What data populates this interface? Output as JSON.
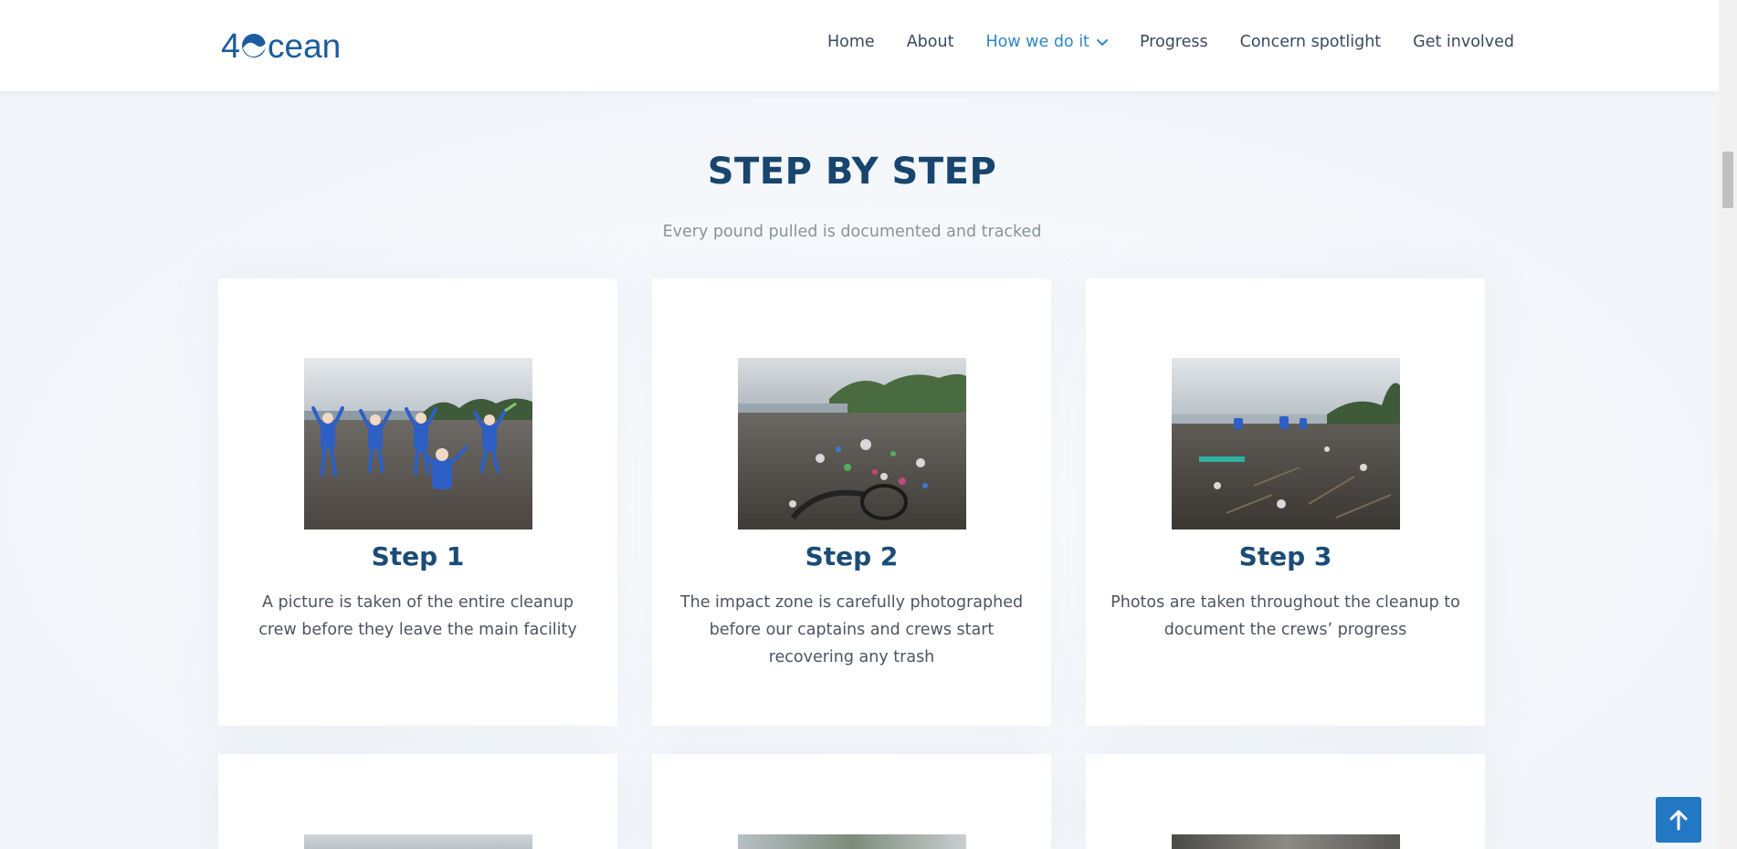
{
  "header": {
    "logo_text": "4Ocean",
    "nav": [
      {
        "label": "Home"
      },
      {
        "label": "About"
      },
      {
        "label": "How we do it",
        "active": true
      },
      {
        "label": "Progress"
      },
      {
        "label": "Concern spotlight"
      },
      {
        "label": "Get involved"
      }
    ]
  },
  "section": {
    "title": "STEP BY STEP",
    "subtitle": "Every pound pulled is documented and tracked"
  },
  "steps": [
    {
      "title": "Step 1",
      "text": "A picture is taken of the entire cleanup crew before they leave the main facility",
      "photo": "crew-on-beach-photo"
    },
    {
      "title": "Step 2",
      "text": "The impact zone is carefully photographed before our captains and crews start recovering any trash",
      "photo": "trash-on-beach-photo"
    },
    {
      "title": "Step 3",
      "text": "Photos are taken throughout the cleanup to document the crews’ progress",
      "photo": "crew-cleaning-photo"
    }
  ],
  "colors": {
    "brand": "#1b5c9e",
    "accent": "#2f86c6",
    "title": "#17456e",
    "back_to_top": "#2378c3"
  },
  "icons": {
    "dropdown": "chevron-down-icon",
    "back_to_top": "arrow-up-icon"
  }
}
